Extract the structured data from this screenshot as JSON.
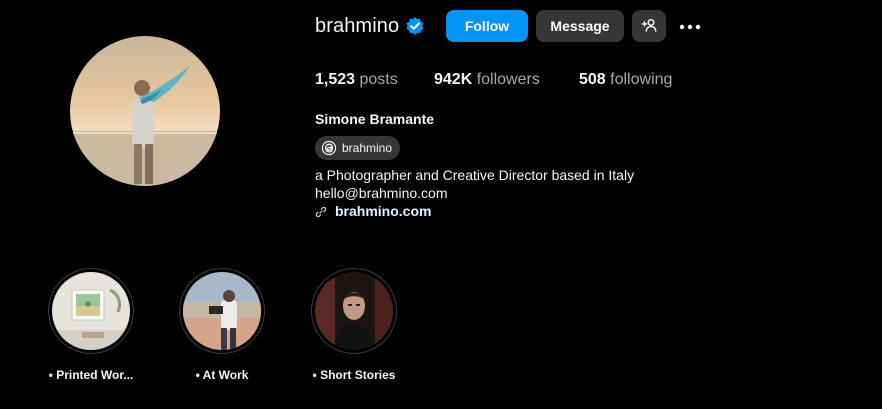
{
  "profile": {
    "username": "brahmino",
    "verified": true,
    "full_name": "Simone Bramante",
    "threads_handle": "brahmino",
    "bio_line_1": "a Photographer and Creative Director based in Italy",
    "bio_line_2": "hello@brahmino.com",
    "website": "brahmino.com"
  },
  "actions": {
    "follow_label": "Follow",
    "message_label": "Message",
    "add_user_icon": "add-user-icon",
    "more_icon": "more-options-icon"
  },
  "stats": {
    "posts_count": "1,523",
    "posts_label": "posts",
    "followers_count": "942K",
    "followers_label": "followers",
    "following_count": "508",
    "following_label": "following"
  },
  "highlights": [
    {
      "label": "• Printed Wor..."
    },
    {
      "label": "• At Work"
    },
    {
      "label": "• Short Stories"
    }
  ],
  "colors": {
    "background": "#000000",
    "follow_button": "#0095f6",
    "secondary_button": "#363636",
    "verified_badge": "#0095f6",
    "muted_text": "#a8a8a8",
    "link_text": "#e0f1ff"
  }
}
